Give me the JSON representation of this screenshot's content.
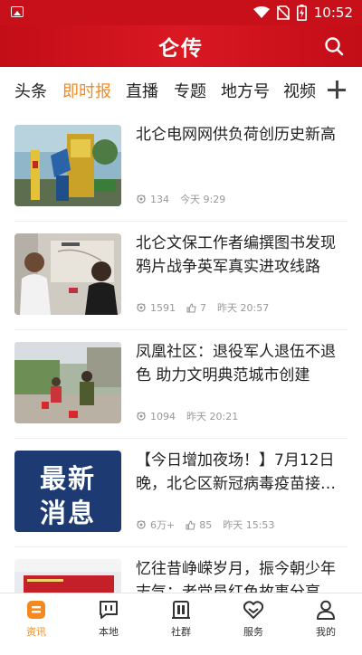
{
  "status_bar": {
    "time": "10:52"
  },
  "header": {
    "title": "仑传"
  },
  "tabs": [
    "头条",
    "即时报",
    "直播",
    "专题",
    "地方号",
    "视频"
  ],
  "active_tab": "即时报",
  "news": [
    {
      "title": "北仑电网网供负荷创历史新高",
      "views": "134",
      "likes": "",
      "time": "今天 9:29"
    },
    {
      "title": "北仑文保工作者编撰图书发现鸦片战争英军真实进攻线路",
      "views": "1591",
      "likes": "7",
      "time": "昨天 20:57"
    },
    {
      "title": "凤凰社区：退役军人退伍不退色 助力文明典范城市创建",
      "views": "1094",
      "likes": "",
      "time": "昨天 20:21"
    },
    {
      "title": "【今日增加夜场！】7月12日晚，北仑区新冠病毒疫苗接…",
      "views": "6万+",
      "likes": "85",
      "time": "昨天 15:53",
      "thumb_text": [
        "最新",
        "消息"
      ]
    },
    {
      "title": "忆往昔峥嵘岁月，振今朝少年志气：老党员红色故事分享…",
      "views": "",
      "likes": "",
      "time": ""
    }
  ],
  "bottom_nav": [
    "资讯",
    "本地",
    "社群",
    "服务",
    "我的"
  ],
  "colors": {
    "brand_red": "#c8101a",
    "accent_orange": "#f5891f"
  }
}
